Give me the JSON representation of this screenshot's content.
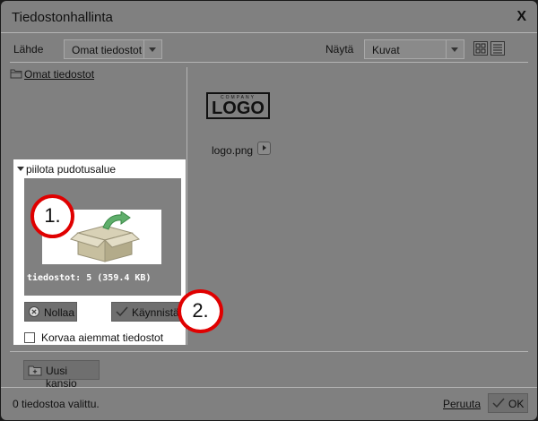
{
  "window": {
    "title": "Tiedostonhallinta",
    "close_label": "X"
  },
  "toolbar": {
    "source_label": "Lähde",
    "source_value": "Omat tiedostot",
    "view_label": "Näytä",
    "view_value": "Kuvat"
  },
  "tree": {
    "root_folder": "Omat tiedostot"
  },
  "upload": {
    "toggle_label": "piilota pudotusalue",
    "info": "tiedostot: 5 (359.4 KB)",
    "reset_label": "Nollaa",
    "start_label": "Käynnistä",
    "overwrite_label": "Korvaa aiemmat tiedostot"
  },
  "markers": {
    "first": "1.",
    "second": "2."
  },
  "files": [
    {
      "name": "logo.png",
      "logo_small": "COMPANY",
      "logo_big": "LOGO"
    }
  ],
  "footer": {
    "new_folder_label": "Uusi kansio",
    "status": "0 tiedostoa valittu.",
    "cancel_label": "Peruuta",
    "ok_label": "OK"
  },
  "colors": {
    "marker_ring": "#e00000",
    "dialog_bg": "#808080"
  }
}
